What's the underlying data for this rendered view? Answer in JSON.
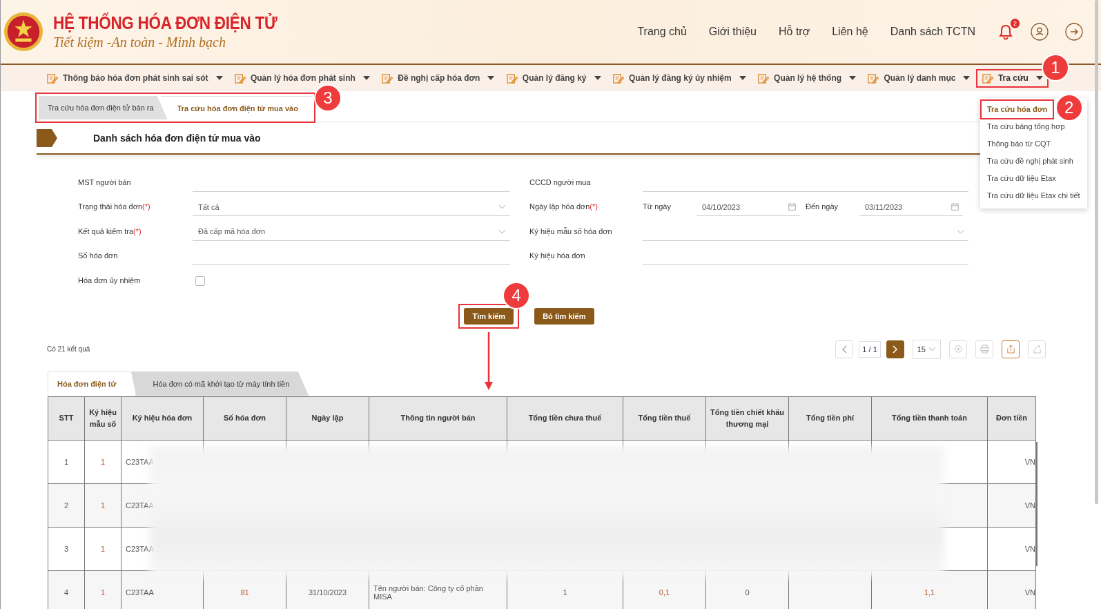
{
  "header": {
    "title": "HỆ THỐNG HÓA ĐƠN ĐIỆN TỬ",
    "slogan": "Tiết kiệm -An toàn - Minh bạch",
    "links": [
      "Trang chủ",
      "Giới thiệu",
      "Hỗ trợ",
      "Liên hệ",
      "Danh sách TCTN"
    ],
    "notification_count": "2"
  },
  "nav": [
    {
      "label": "Thông báo hóa đơn phát sinh sai sót",
      "expanded": false
    },
    {
      "label": "Quản lý hóa đơn phát sinh",
      "expanded": false
    },
    {
      "label": "Đề nghị cấp hóa đơn",
      "expanded": false
    },
    {
      "label": "Quản lý đăng ký",
      "expanded": false
    },
    {
      "label": "Quản lý đăng ký ủy nhiệm",
      "expanded": false
    },
    {
      "label": "Quản lý hệ thống",
      "expanded": false
    },
    {
      "label": "Quản lý danh mục",
      "expanded": false
    },
    {
      "label": "Tra cứu",
      "expanded": true,
      "annotation": "1"
    }
  ],
  "dropdown": [
    {
      "label": "Tra cứu hóa đơn",
      "selected": true,
      "annotation": "2"
    },
    {
      "label": "Tra cứu bảng tổng hợp",
      "selected": false
    },
    {
      "label": "Thông báo từ CQT",
      "selected": false
    },
    {
      "label": "Tra cứu đề nghị phát sinh",
      "selected": false
    },
    {
      "label": "Tra cứu dữ liệu Etax",
      "selected": false
    },
    {
      "label": "Tra cứu dữ liệu Etax chi tiết",
      "selected": false
    }
  ],
  "page_tabs": {
    "annotation": "3",
    "items": [
      {
        "label": "Tra cứu hóa đơn điện tử bán ra",
        "selected": false
      },
      {
        "label": "Tra cứu hóa đơn điện tử mua vào",
        "selected": true
      }
    ]
  },
  "section_title": "Danh sách hóa đơn điện tử mua vào",
  "form": {
    "left": [
      {
        "kind": "text",
        "label": "MST người bán"
      },
      {
        "kind": "select",
        "label": "Trạng thái hóa đơn",
        "required_mark": "(*)",
        "value": "Tất cả"
      },
      {
        "kind": "select",
        "label": "Kết quả kiểm tra",
        "required_mark": "(*)",
        "value": "Đã cấp mã hóa đơn"
      },
      {
        "kind": "text",
        "label": "Số hóa đơn"
      },
      {
        "kind": "checkbox",
        "label": "Hóa đơn ủy nhiệm",
        "checked": false
      }
    ],
    "right": [
      {
        "kind": "text",
        "label": "CCCD người mua"
      },
      {
        "kind": "daterange",
        "label": "Ngày lập hóa đơn",
        "required_mark": "(*)",
        "from_label": "Từ ngày",
        "from": "04/10/2023",
        "to_label": "Đến ngày",
        "to": "03/11/2023"
      },
      {
        "kind": "select",
        "label": "Ký hiệu mẫu số hóa đơn"
      },
      {
        "kind": "text",
        "label": "Ký hiệu hóa đơn"
      }
    ]
  },
  "buttons": [
    {
      "label": "Tìm kiếm",
      "annotation": "4"
    },
    {
      "label": "Bỏ tìm kiếm"
    }
  ],
  "results": "Có 21 kết quả",
  "pager": {
    "page": "1 / 1",
    "page_size": "15"
  },
  "table_tabs": [
    {
      "label": "Hóa đơn điện tử",
      "selected": true
    },
    {
      "label": "Hóa đơn có mã khởi tạo từ máy tính tiền",
      "selected": false
    }
  ],
  "table": {
    "columns": [
      "STT",
      "Ký hiệu mẫu số",
      "Ký hiệu hóa đơn",
      "Số hóa đơn",
      "Ngày lập",
      "Thông tin người bán",
      "Tổng tiền chưa thuế",
      "Tổng tiền thuế",
      "Tổng tiền chiết khấu thương mại",
      "Tổng tiền phí",
      "Tổng tiền thanh toán",
      "Đơn tiền"
    ],
    "rows": [
      {
        "cells": [
          "1",
          "1",
          "C23TAA",
          "",
          "",
          "",
          "",
          "",
          "",
          "",
          "",
          "VN"
        ]
      },
      {
        "cells": [
          "2",
          "1",
          "C23TAA",
          "",
          "",
          "",
          "",
          "",
          "",
          "",
          "",
          "VN"
        ]
      },
      {
        "cells": [
          "3",
          "1",
          "C23TAA",
          "",
          "",
          "",
          "",
          "",
          "",
          "",
          "",
          "VN"
        ]
      },
      {
        "cells": [
          "4",
          "1",
          "C23TAA",
          "81",
          "31/10/2023",
          "Tên người bán: Công ty cổ phần MISA",
          "1",
          "0,1",
          "0",
          "",
          "1,1",
          "VN"
        ]
      }
    ]
  }
}
